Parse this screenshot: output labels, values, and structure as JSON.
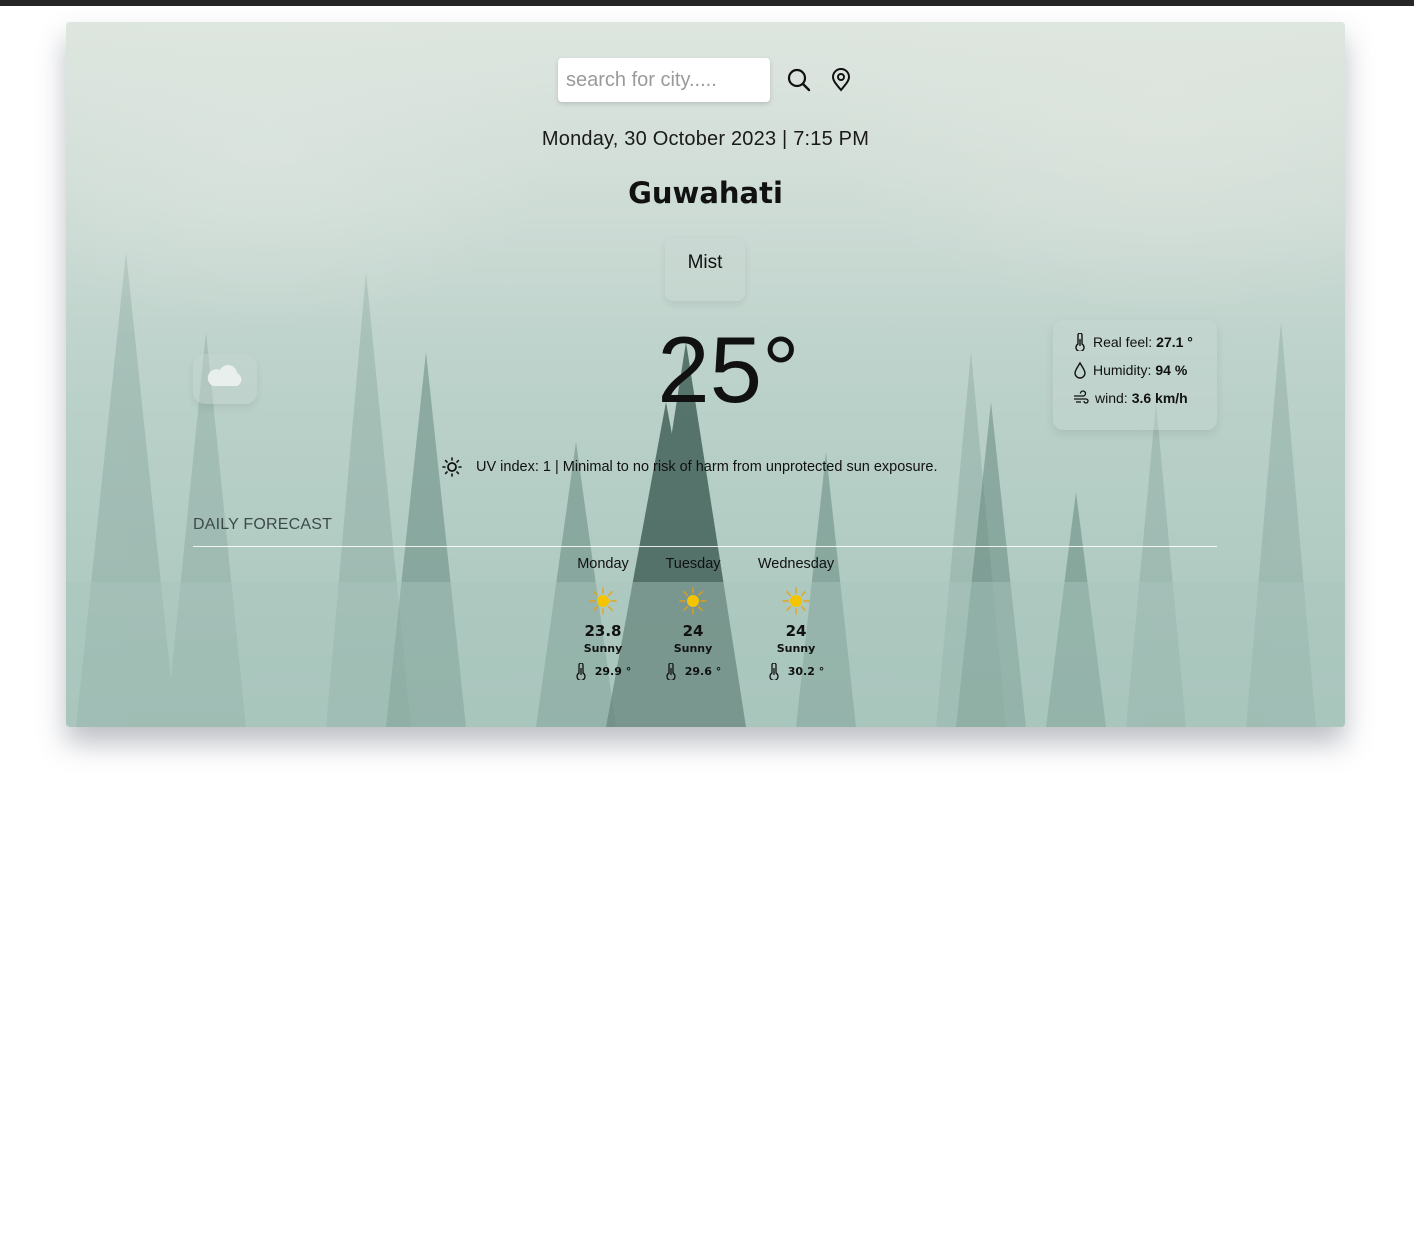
{
  "search": {
    "placeholder": "search for city....."
  },
  "header": {
    "datetime": "Monday, 30 October 2023 | 7:15 PM",
    "city": "Guwahati"
  },
  "current": {
    "condition": "Mist",
    "temperature": "25°",
    "details": {
      "real_feel_label": "Real feel:",
      "real_feel_value": "27.1 °",
      "humidity_label": "Humidity:",
      "humidity_value": "94 %",
      "wind_label": "wind:",
      "wind_value": "3.6 km/h"
    },
    "uv_text": "UV index: 1 | Minimal to no risk of harm from unprotected sun exposure."
  },
  "forecast": {
    "title": "DAILY FORECAST",
    "days": [
      {
        "day": "Monday",
        "temp": "23.8",
        "condition": "Sunny",
        "feel": "29.9 °"
      },
      {
        "day": "Tuesday",
        "temp": "24",
        "condition": "Sunny",
        "feel": "29.6 °"
      },
      {
        "day": "Wednesday",
        "temp": "24",
        "condition": "Sunny",
        "feel": "30.2 °"
      }
    ]
  },
  "icons": {
    "search": "search-icon",
    "location": "map-pin-icon",
    "cloud": "cloud-icon",
    "thermometer": "thermometer-icon",
    "humidity": "droplet-icon",
    "wind": "wind-icon",
    "uv": "sun-icon",
    "forecast": "sunny-icon"
  },
  "colors": {
    "sun_core": "#f5c400",
    "sun_rays": "#f0a000",
    "card_tint": "#b7cfc7"
  }
}
